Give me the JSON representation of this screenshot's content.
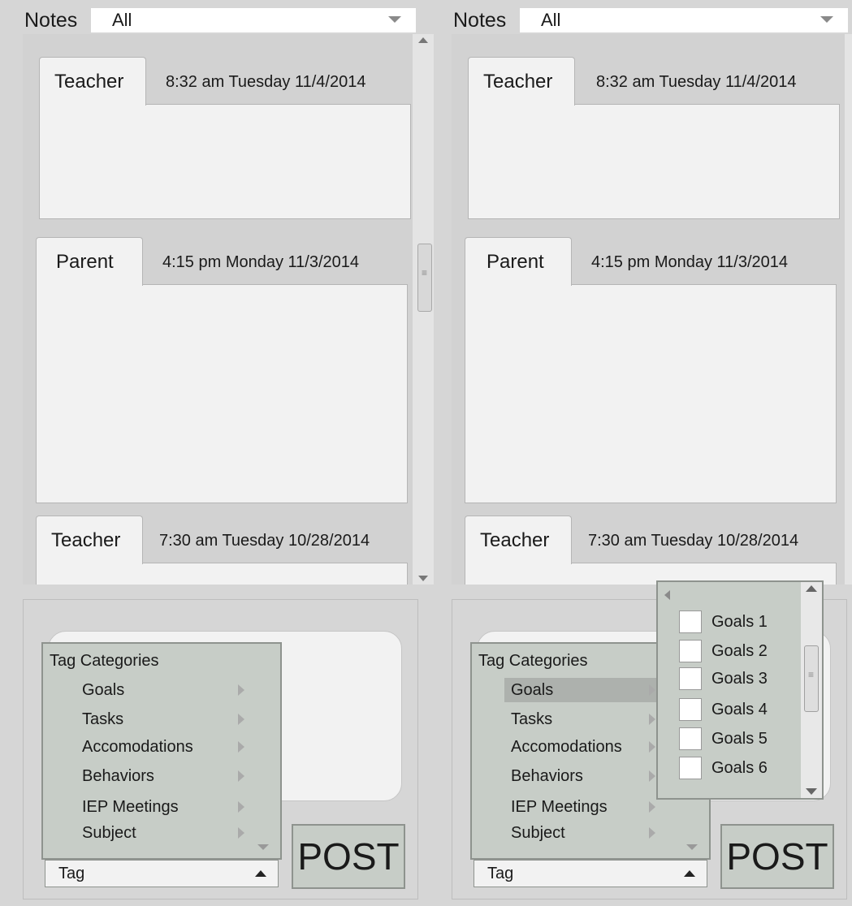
{
  "panels": [
    {
      "notes_label": "Notes",
      "filter_value": "All",
      "notes": [
        {
          "author": "Teacher",
          "timestamp": "8:32 am Tuesday 11/4/2014"
        },
        {
          "author": "Parent",
          "timestamp": "4:15 pm Monday 11/3/2014"
        },
        {
          "author": "Teacher",
          "timestamp": "7:30 am Tuesday 10/28/2014"
        }
      ],
      "tag_menu": {
        "heading": "Tag Categories",
        "items": [
          "Goals",
          "Tasks",
          "Accomodations",
          "Behaviors",
          "IEP Meetings",
          "Subject"
        ],
        "selected": null
      },
      "tag_select_value": "Tag",
      "post_label": "POST"
    },
    {
      "notes_label": "Notes",
      "filter_value": "All",
      "notes": [
        {
          "author": "Teacher",
          "timestamp": "8:32 am Tuesday 11/4/2014"
        },
        {
          "author": "Parent",
          "timestamp": "4:15 pm Monday 11/3/2014"
        },
        {
          "author": "Teacher",
          "timestamp": "7:30 am Tuesday 10/28/2014"
        }
      ],
      "tag_menu": {
        "heading": "Tag Categories",
        "items": [
          "Goals",
          "Tasks",
          "Accomodations",
          "Behaviors",
          "IEP Meetings",
          "Subject"
        ],
        "selected": "Goals"
      },
      "tag_select_value": "Tag",
      "post_label": "POST",
      "goals_submenu": [
        "Goals 1",
        "Goals 2",
        "Goals 3",
        "Goals 4",
        "Goals 5",
        "Goals 6"
      ]
    }
  ],
  "colors": {
    "background": "#d6d6d6",
    "menu": "#c7cdc7",
    "menu_selected": "#adb1ad",
    "note_body": "#f2f2f2"
  }
}
